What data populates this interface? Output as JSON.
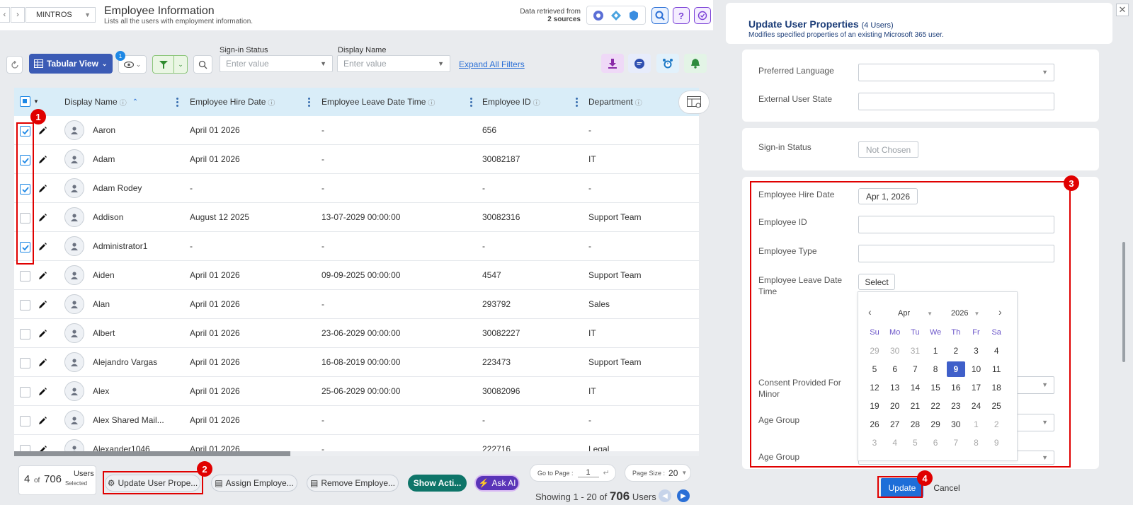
{
  "header": {
    "tenant": "MINTROS",
    "title": "Employee Information",
    "subtitle": "Lists all the users with employment information.",
    "data_retrieved_line1": "Data retrieved from",
    "data_retrieved_line2": "2 sources"
  },
  "toolbar": {
    "view_label": "Tabular View",
    "view_badge": "1",
    "filters": [
      {
        "label": "Sign-in Status",
        "placeholder": "Enter value"
      },
      {
        "label": "Display Name",
        "placeholder": "Enter value"
      }
    ],
    "expand_filters": "Expand All Filters"
  },
  "columns": [
    "Display Name",
    "Employee Hire Date",
    "Employee Leave Date Time",
    "Employee ID",
    "Department"
  ],
  "rows": [
    {
      "checked": true,
      "name": "Aaron",
      "hire": "April 01 2026",
      "leave": "-",
      "id": "656",
      "dept": "-"
    },
    {
      "checked": true,
      "name": "Adam",
      "hire": "April 01 2026",
      "leave": "-",
      "id": "30082187",
      "dept": "IT"
    },
    {
      "checked": true,
      "name": "Adam Rodey",
      "hire": "-",
      "leave": "-",
      "id": "-",
      "dept": "-"
    },
    {
      "checked": false,
      "name": "Addison",
      "hire": "August 12 2025",
      "leave": "13-07-2029 00:00:00",
      "id": "30082316",
      "dept": "Support Team"
    },
    {
      "checked": true,
      "name": "Administrator1",
      "hire": "-",
      "leave": "-",
      "id": "-",
      "dept": "-"
    },
    {
      "checked": false,
      "name": "Aiden",
      "hire": "April 01 2026",
      "leave": "09-09-2025 00:00:00",
      "id": "4547",
      "dept": "Support Team"
    },
    {
      "checked": false,
      "name": "Alan",
      "hire": "April 01 2026",
      "leave": "-",
      "id": "293792",
      "dept": "Sales"
    },
    {
      "checked": false,
      "name": "Albert",
      "hire": "April 01 2026",
      "leave": "23-06-2029 00:00:00",
      "id": "30082227",
      "dept": "IT"
    },
    {
      "checked": false,
      "name": "Alejandro Vargas",
      "hire": "April 01 2026",
      "leave": "16-08-2019 00:00:00",
      "id": "223473",
      "dept": "Support Team"
    },
    {
      "checked": false,
      "name": "Alex",
      "hire": "April 01 2026",
      "leave": "25-06-2029 00:00:00",
      "id": "30082096",
      "dept": "IT"
    },
    {
      "checked": false,
      "name": "Alex Shared Mail...",
      "hire": "April 01 2026",
      "leave": "-",
      "id": "-",
      "dept": "-"
    },
    {
      "checked": false,
      "name": "Alexander1046",
      "hire": "April 01 2026",
      "leave": "-",
      "id": "222716",
      "dept": "Legal"
    }
  ],
  "footer": {
    "selected_count": "4",
    "of_label": "of",
    "total": "706",
    "users_label": "Users",
    "selected_label": "Selected",
    "actions": [
      "Update User Prope...",
      "Assign Employe...",
      "Remove Employe..."
    ],
    "show_actions": "Show Acti...",
    "ask_ai": "Ask AI",
    "goto_label": "Go to Page :",
    "goto_value": "1",
    "page_size_label": "Page Size :",
    "page_size_value": "20",
    "showing_prefix": "Showing 1 - 20 of",
    "showing_total": "706",
    "showing_suffix": "Users"
  },
  "panel": {
    "title": "Update User Properties",
    "title_count": "(4 Users)",
    "subtitle": "Modifies specified properties of an existing Microsoft 365 user.",
    "preferred_language": "Preferred Language",
    "external_user_state": "External User State",
    "sign_in_status": "Sign-in Status",
    "sign_in_value": "Not Chosen",
    "hire_date_label": "Employee Hire Date",
    "hire_date_value": "Apr 1, 2026",
    "employee_id_label": "Employee ID",
    "employee_type_label": "Employee Type",
    "leave_label_1": "Employee Leave Date",
    "leave_label_2": "Time",
    "select_label": "Select",
    "consent_label_1": "Consent Provided For",
    "consent_label_2": "Minor",
    "age_group_1": "Age Group",
    "age_group_2": "Age Group",
    "update": "Update",
    "cancel": "Cancel"
  },
  "calendar": {
    "month": "Apr",
    "year": "2026",
    "dow": [
      "Su",
      "Mo",
      "Tu",
      "We",
      "Th",
      "Fr",
      "Sa"
    ],
    "days": [
      [
        "29",
        "30",
        "31",
        "1",
        "2",
        "3",
        "4"
      ],
      [
        "5",
        "6",
        "7",
        "8",
        "9",
        "10",
        "11"
      ],
      [
        "12",
        "13",
        "14",
        "15",
        "16",
        "17",
        "18"
      ],
      [
        "19",
        "20",
        "21",
        "22",
        "23",
        "24",
        "25"
      ],
      [
        "26",
        "27",
        "28",
        "29",
        "30",
        "1",
        "2"
      ],
      [
        "3",
        "4",
        "5",
        "6",
        "7",
        "8",
        "9"
      ]
    ],
    "selected": "9"
  },
  "callouts": [
    "1",
    "2",
    "3",
    "4"
  ],
  "colors": {
    "accent": "#3b5bb5",
    "selected_day": "#3f5fc9",
    "callout": "#e00000",
    "header_row": "#d9edf8"
  }
}
